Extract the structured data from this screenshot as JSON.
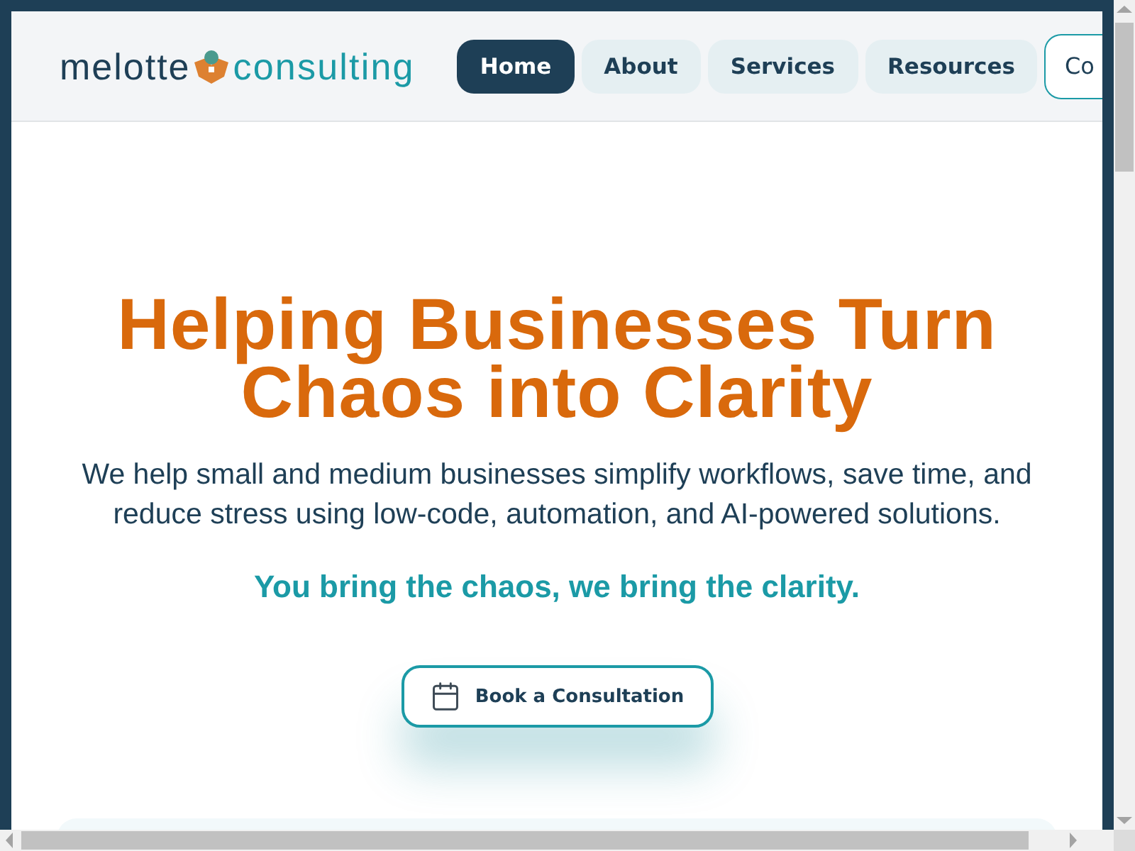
{
  "header": {
    "logo": {
      "first": "melotte",
      "second": "consulting"
    },
    "nav": [
      {
        "label": "Home",
        "selected": true,
        "kind": "pill"
      },
      {
        "label": "About",
        "selected": false,
        "kind": "pill"
      },
      {
        "label": "Services",
        "selected": false,
        "kind": "pill"
      },
      {
        "label": "Resources",
        "selected": false,
        "kind": "pill"
      },
      {
        "label": "Co",
        "selected": false,
        "kind": "outline"
      }
    ]
  },
  "hero": {
    "title": "Helping Businesses Turn Chaos into Clarity",
    "subtitle": "We help small and medium businesses simplify workflows, save time, and reduce stress using low-code, automation, and AI-powered solutions.",
    "tagline": "You bring the chaos, we bring the clarity.",
    "button": "Book a Consultation"
  }
}
